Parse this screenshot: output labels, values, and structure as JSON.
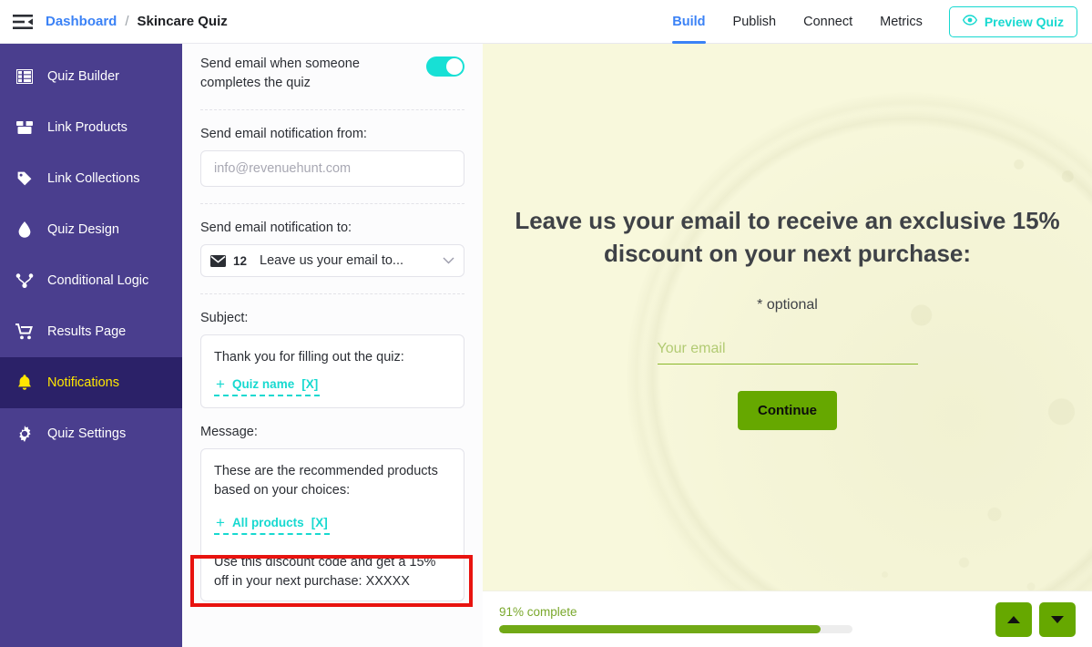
{
  "topbar": {
    "menu_icon": "collapse-sidebar-icon",
    "breadcrumb": {
      "root": "Dashboard",
      "separator": "/",
      "current": "Skincare Quiz"
    },
    "nav": [
      {
        "label": "Build",
        "active": true
      },
      {
        "label": "Publish",
        "active": false
      },
      {
        "label": "Connect",
        "active": false
      },
      {
        "label": "Metrics",
        "active": false
      }
    ],
    "preview_button": {
      "label": "Preview Quiz",
      "icon": "eye-icon",
      "color": "#17d9d0"
    }
  },
  "sidebar": {
    "background": "#4a3e8e",
    "active_background": "#2b2168",
    "active_color": "#ffe600",
    "items": [
      {
        "label": "Quiz Builder",
        "icon": "list-icon",
        "active": false
      },
      {
        "label": "Link Products",
        "icon": "box-icon",
        "active": false
      },
      {
        "label": "Link Collections",
        "icon": "tag-icon",
        "active": false
      },
      {
        "label": "Quiz Design",
        "icon": "droplet-icon",
        "active": false
      },
      {
        "label": "Conditional Logic",
        "icon": "sitemap-icon",
        "active": false
      },
      {
        "label": "Results Page",
        "icon": "cart-icon",
        "active": false
      },
      {
        "label": "Notifications",
        "icon": "bell-icon",
        "active": true
      },
      {
        "label": "Quiz Settings",
        "icon": "gear-icon",
        "active": false
      }
    ]
  },
  "panel": {
    "toggle_row": {
      "label": "Send email when someone completes the quiz",
      "enabled": true,
      "color": "#17e0d5"
    },
    "from": {
      "label": "Send email notification from:",
      "value": "",
      "placeholder": "info@revenuehunt.com"
    },
    "to": {
      "label": "Send email notification to:",
      "count": "12",
      "selected": "Leave us your email to...",
      "mail_icon": "envelope-icon",
      "chevron": "chevron-down-icon"
    },
    "subject": {
      "label": "Subject:",
      "text": "Thank you for filling out the quiz:",
      "tag": {
        "plus": "+",
        "name": "Quiz name",
        "remove": "[X]"
      }
    },
    "message": {
      "label": "Message:",
      "paragraph_1": "These are the recommended products based on your choices:",
      "tag": {
        "plus": "+",
        "name": "All products",
        "remove": "[X]"
      },
      "paragraph_2": "Use this discount code and get a 15% off in your next purchase: XXXXX"
    },
    "highlight_color": "#e8130f"
  },
  "preview": {
    "background": "#f8f8dc",
    "question_title": "Leave us your email to receive an exclusive 15% discount on your next purchase:",
    "optional_note": "* optional",
    "email_placeholder": "Your email",
    "continue_label": "Continue",
    "progress": {
      "label": "91% complete",
      "percent": 91,
      "color": "#71a916"
    },
    "nav": {
      "up": "triangle-up-icon",
      "down": "triangle-down-icon",
      "color": "#66a800"
    }
  }
}
